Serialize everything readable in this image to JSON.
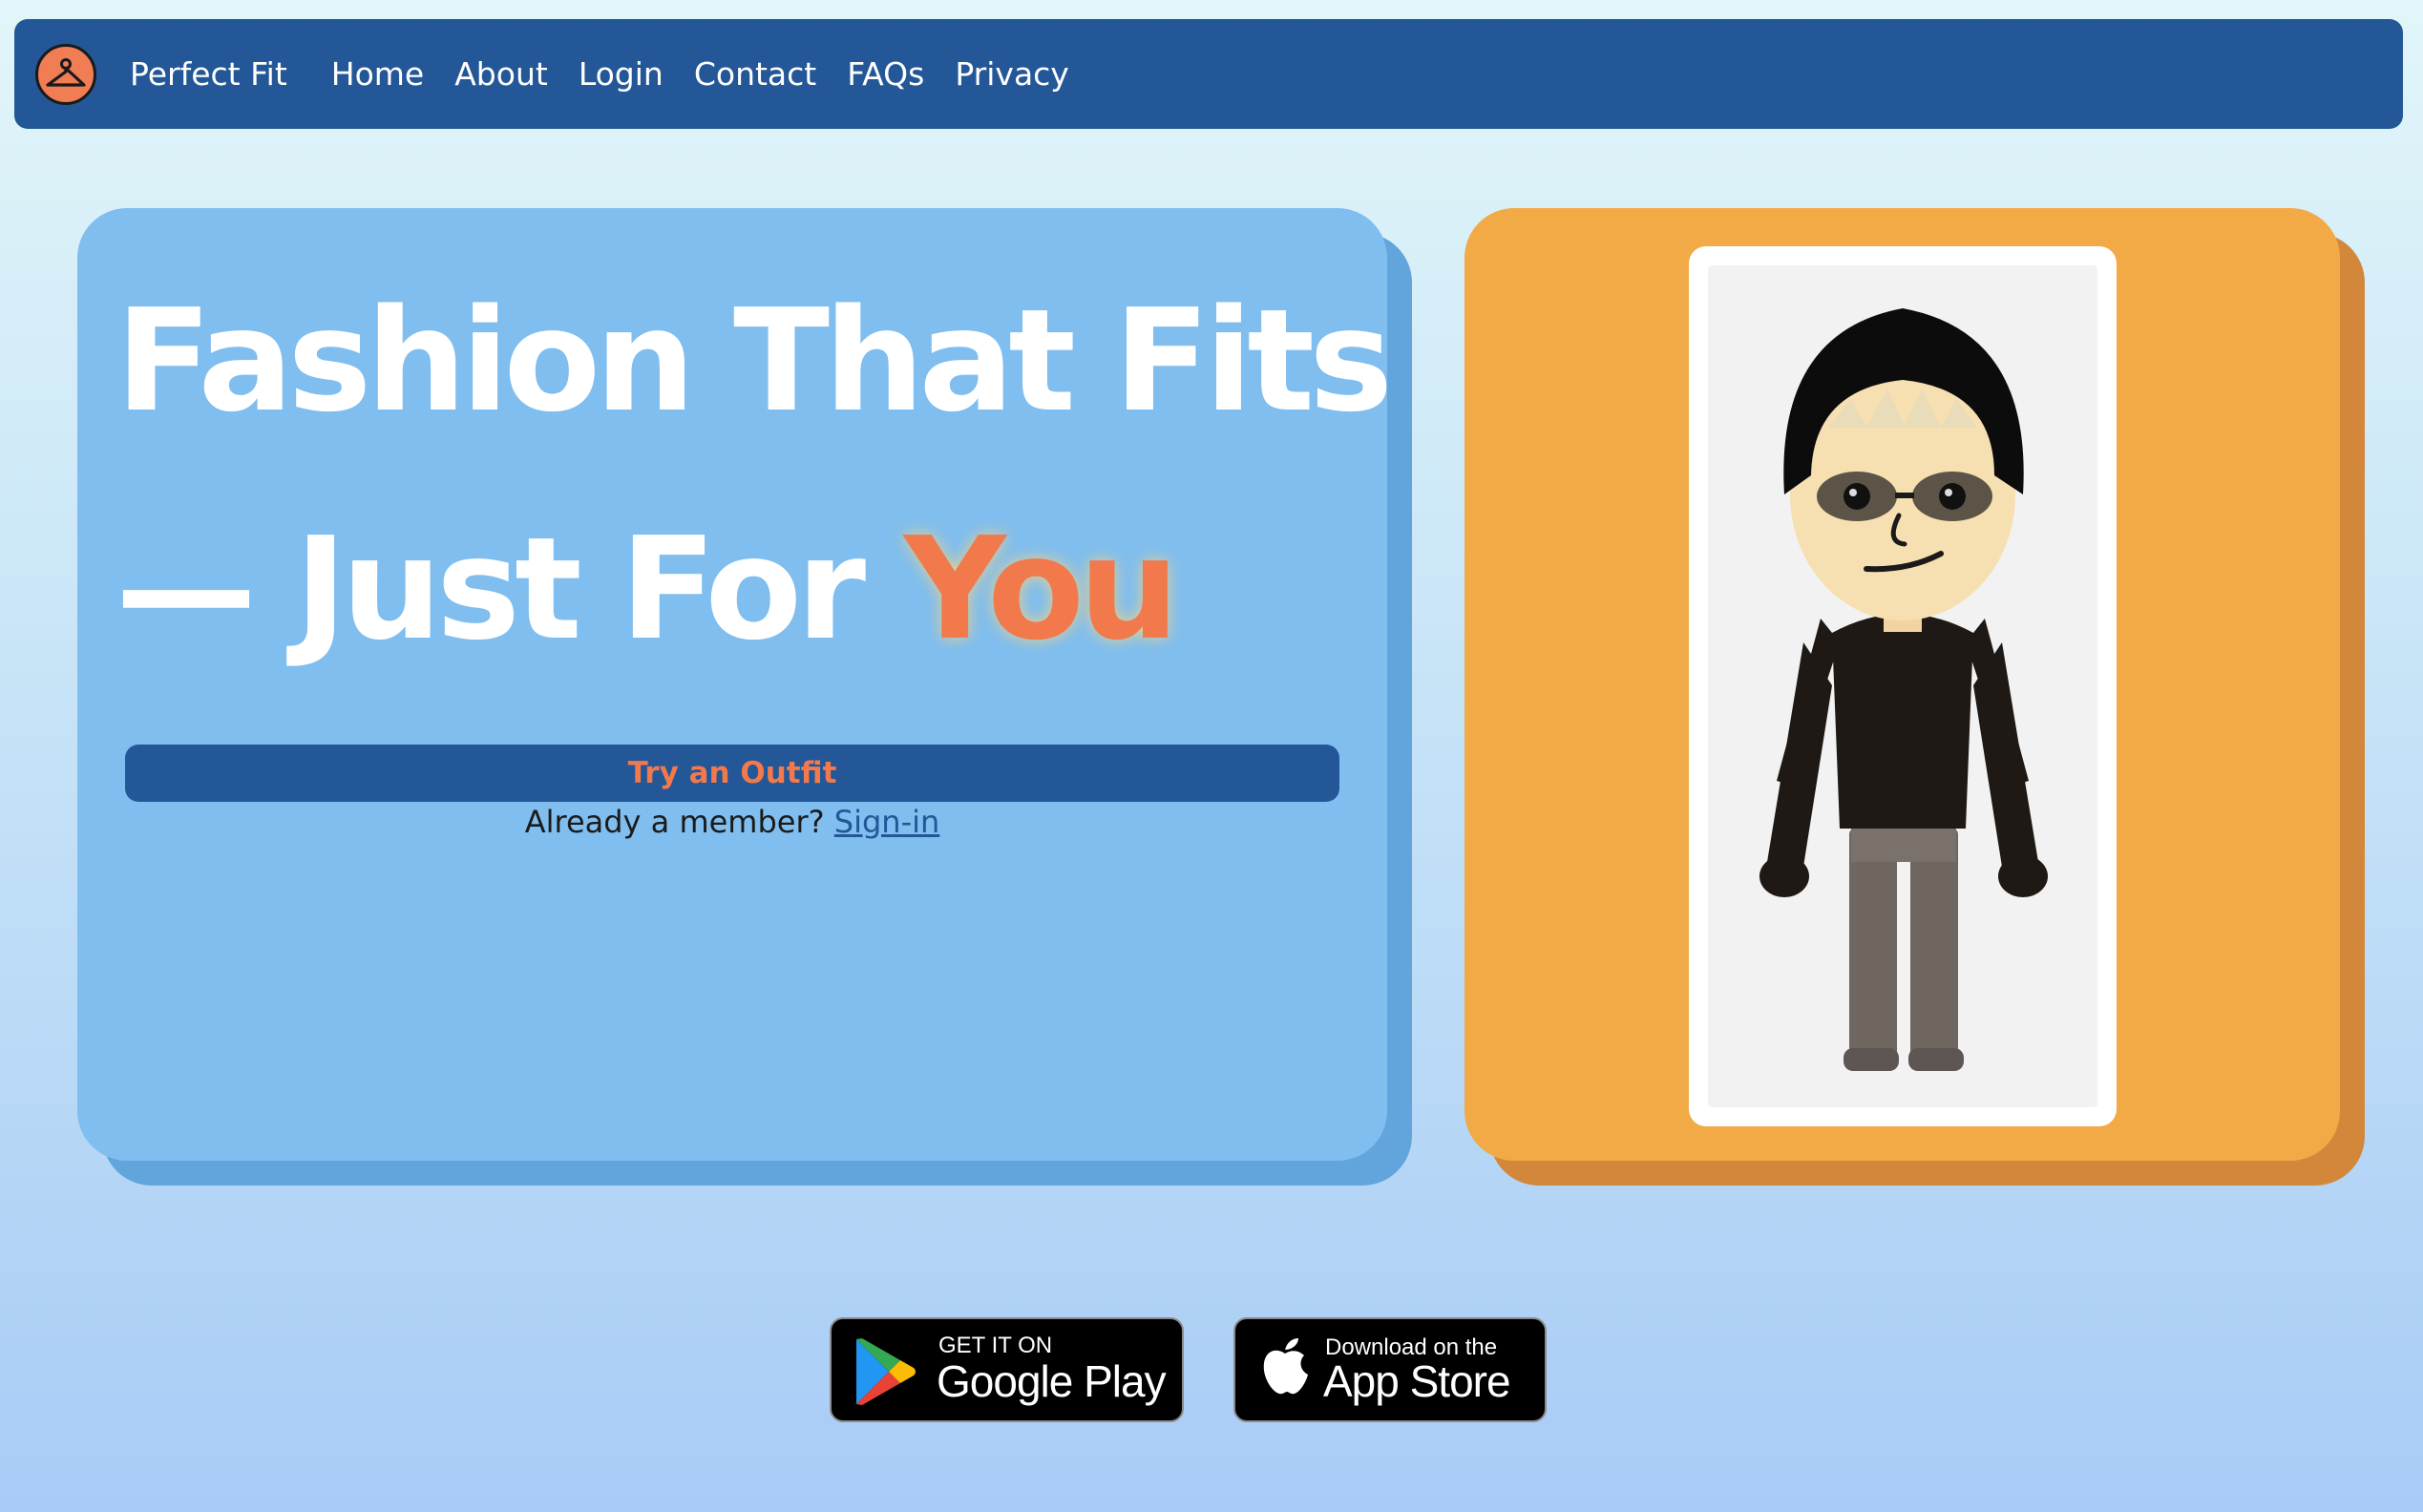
{
  "nav": {
    "brand": "Perfect Fit",
    "links": [
      "Home",
      "About",
      "Login",
      "Contact",
      "FAQs",
      "Privacy"
    ]
  },
  "hero": {
    "line1": "Fashion That Fits",
    "line2_prefix": "— Just For ",
    "line2_accent": "You",
    "cta_label": "Try an Outfit",
    "member_prompt": "Already a member?",
    "signin_label": "Sign-in"
  },
  "stores": {
    "google": {
      "small": "GET IT ON",
      "big": "Google Play"
    },
    "apple": {
      "small": "Download on the",
      "big": "App Store"
    }
  },
  "icons": {
    "logo": "hanger-icon",
    "google": "google-play-icon",
    "apple": "apple-icon",
    "avatar": "avatar-figure"
  },
  "colors": {
    "nav_bg": "#235797",
    "hero_card": "#7fbeef",
    "accent": "#f1794c",
    "avatar_card": "#f2aa47"
  }
}
